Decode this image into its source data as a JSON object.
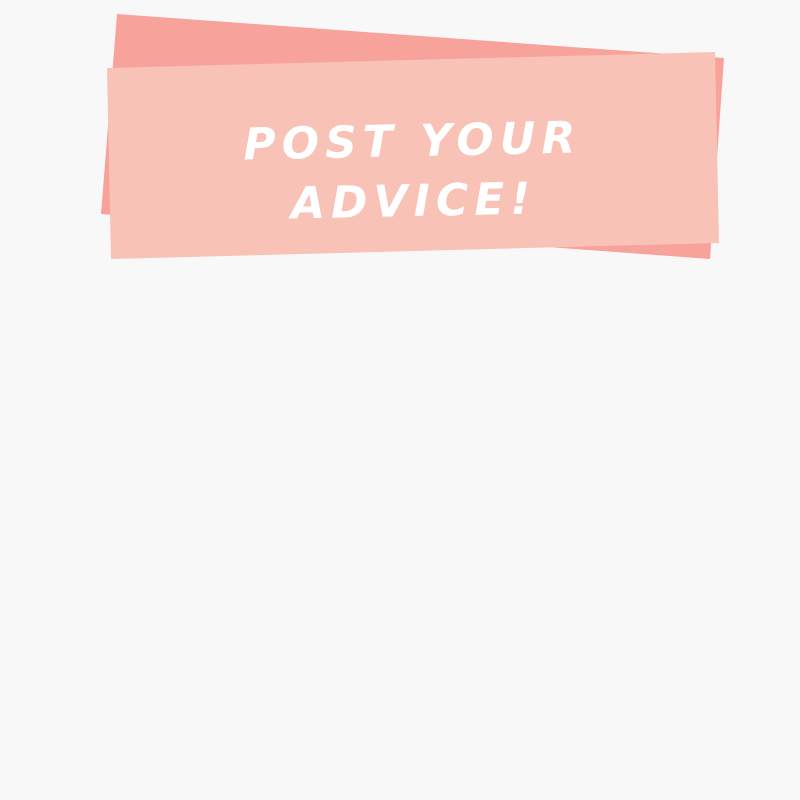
{
  "banner": {
    "line1": "POST YOUR",
    "line2": "ADVICE!",
    "colors": {
      "back_strip": "#f8a29c",
      "front_strip": "#f8c2b6",
      "text": "#ffffff",
      "background": "#f8f8f9"
    }
  }
}
